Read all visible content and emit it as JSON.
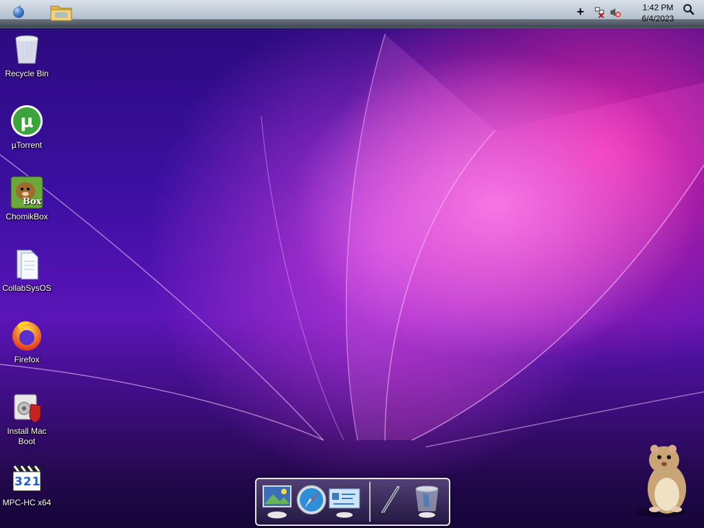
{
  "topbar": {
    "clock_time": "1:42 PM",
    "clock_date": "6/4/2023",
    "apple_icon": "apple-icon",
    "folder_icon": "folder-icon",
    "plus_icon": "plus-icon",
    "network_icon": "network-disconnected-icon",
    "volume_icon": "volume-muted-icon",
    "search_icon": "search-icon"
  },
  "desktop": {
    "icons": [
      {
        "label": "Recycle Bin",
        "icon": "recycle-bin-icon"
      },
      {
        "label": "µTorrent",
        "icon": "utorrent-icon"
      },
      {
        "label": "ChomikBox",
        "icon": "chomikbox-icon"
      },
      {
        "label": "CollabSysOS",
        "icon": "document-folder-icon"
      },
      {
        "label": "Firefox",
        "icon": "firefox-icon"
      },
      {
        "label": "Install Mac Boot",
        "icon": "installer-icon"
      },
      {
        "label": "MPC-HC x64",
        "icon": "mpc-hc-icon"
      }
    ],
    "chomikbox_badge": "Box",
    "mpc_badge": "321"
  },
  "dock": {
    "items": [
      {
        "icon": "finder-monitor-icon"
      },
      {
        "icon": "safari-compass-icon"
      },
      {
        "icon": "address-book-icon"
      },
      {
        "icon": "pen-tool-icon"
      },
      {
        "icon": "trash-icon"
      }
    ]
  },
  "colors": {
    "wallpaper_primary": "#5a14b8",
    "wallpaper_accent": "#ff28aa",
    "menubar": "#c4ceda"
  }
}
